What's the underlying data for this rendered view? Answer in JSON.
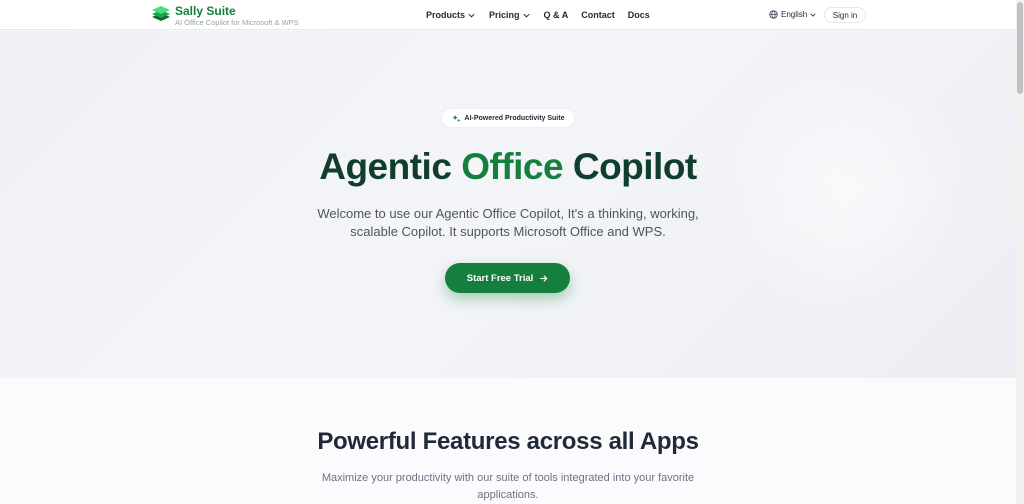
{
  "header": {
    "brand_name": "Sally Suite",
    "brand_tagline": "AI Office Copilot for Microsoft & WPS",
    "nav": [
      {
        "label": "Products",
        "has_dropdown": true
      },
      {
        "label": "Pricing",
        "has_dropdown": true
      },
      {
        "label": "Q & A",
        "has_dropdown": false
      },
      {
        "label": "Contact",
        "has_dropdown": false
      },
      {
        "label": "Docs",
        "has_dropdown": false
      }
    ],
    "language": "English",
    "signin_label": "Sign in"
  },
  "hero": {
    "badge_text": "AI-Powered Productivity Suite",
    "title_part1": "Agentic ",
    "title_accent": "Office",
    "title_part2": " Copilot",
    "description": "Welcome to use our Agentic Office Copilot, It's a thinking, working, scalable Copilot. It supports Microsoft Office and WPS.",
    "cta_label": "Start Free Trial"
  },
  "features": {
    "title": "Powerful Features across all Apps",
    "description": "Maximize your productivity with our suite of tools integrated into your favorite applications."
  },
  "colors": {
    "brand": "#15803d",
    "title_dark": "#0f3d2e"
  },
  "icons": {
    "logo": "layered-diamond-icon",
    "badge": "sparkle-icon",
    "language": "globe-icon",
    "cta": "arrow-right-icon"
  }
}
